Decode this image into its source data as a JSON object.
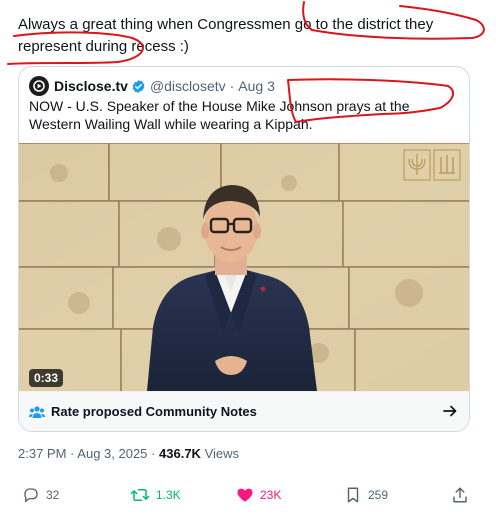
{
  "post": {
    "text": "Always a great thing when Congressmen go to the district they represent during recess :)"
  },
  "quoted_post": {
    "author_name": "Disclose.tv",
    "handle": "@disclosetv",
    "separator": "·",
    "date": "Aug 3",
    "text": "NOW - U.S. Speaker of the House Mike Johnson prays at the Western Wailing Wall while wearing a Kippah.",
    "video_duration": "0:33",
    "community_notes_label": "Rate proposed Community Notes"
  },
  "meta": {
    "time": "2:37 PM",
    "separator": "·",
    "date": "Aug 3, 2025",
    "views_count": "436.7K",
    "views_label": "Views"
  },
  "actions": {
    "replies": "32",
    "reposts": "1.3K",
    "likes": "23K",
    "bookmarks": "259"
  },
  "colors": {
    "repost_active": "#00ba7c",
    "like_active": "#f91880",
    "verified_blue": "#1d9bf0",
    "annotation_red": "#d8161b"
  },
  "icons": [
    "disclose-logo-icon",
    "verified-badge-icon",
    "community-notes-icon",
    "arrow-right-icon",
    "reply-icon",
    "repost-icon",
    "like-icon",
    "bookmark-icon",
    "share-icon"
  ]
}
